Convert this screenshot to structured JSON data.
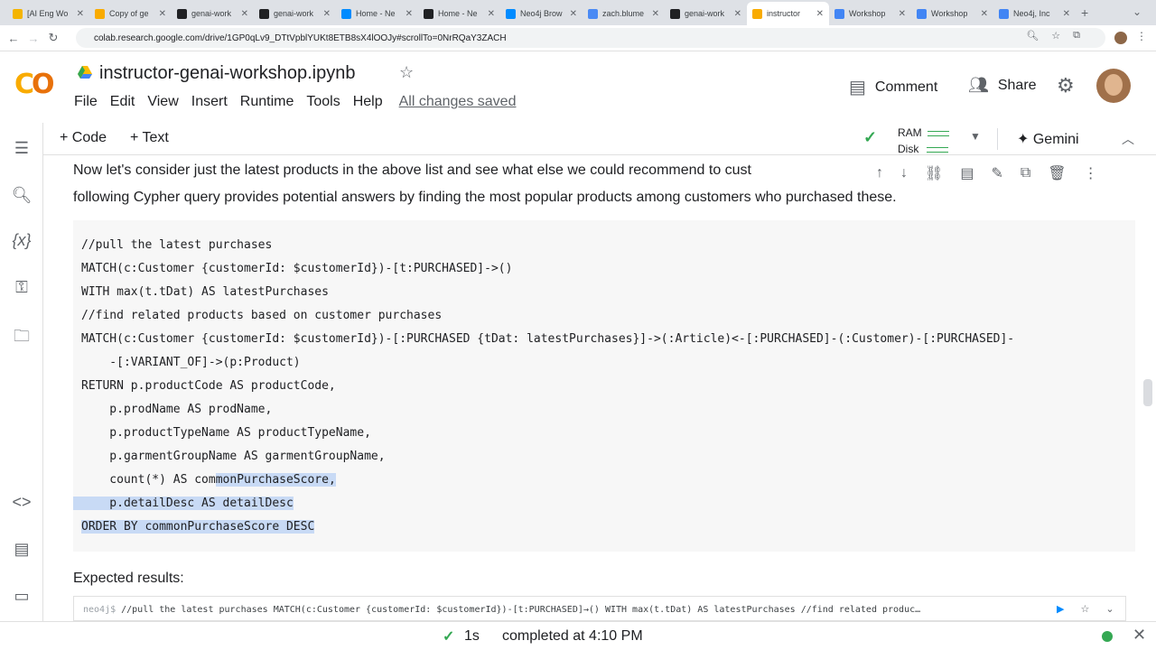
{
  "browser": {
    "tabs": [
      {
        "label": "[AI Eng Wo",
        "color": "#f4b400"
      },
      {
        "label": "Copy of ge",
        "color": "#f9ab00"
      },
      {
        "label": "genai-work",
        "color": "#202124"
      },
      {
        "label": "genai-work",
        "color": "#202124"
      },
      {
        "label": "Home - Ne",
        "color": "#018bff"
      },
      {
        "label": "Home - Ne",
        "color": "#202124"
      },
      {
        "label": "Neo4j Brow",
        "color": "#018bff"
      },
      {
        "label": "zach.blume",
        "color": "#4a8af4"
      },
      {
        "label": "genai-work",
        "color": "#202124"
      },
      {
        "label": "instructor",
        "color": "#f9ab00"
      },
      {
        "label": "Workshop",
        "color": "#4285f4"
      },
      {
        "label": "Workshop",
        "color": "#4285f4"
      },
      {
        "label": "Neo4j, Inc",
        "color": "#4285f4"
      }
    ],
    "url": "colab.research.google.com/drive/1GP0qLv9_DTtVpblYUKt8ETB8sX4lOOJy#scrollTo=0NrRQaY3ZACH"
  },
  "header": {
    "title": "instructor-genai-workshop.ipynb",
    "menu": [
      "File",
      "Edit",
      "View",
      "Insert",
      "Runtime",
      "Tools",
      "Help"
    ],
    "saved_status": "All changes saved",
    "comment_label": "Comment",
    "share_label": "Share"
  },
  "toolbar": {
    "code_label": "+ Code",
    "text_label": "+ Text",
    "ram_label": "RAM",
    "disk_label": "Disk",
    "gemini_label": "Gemini"
  },
  "markdown": {
    "line1": "Now let's consider just the latest products in the above list and see what else we could recommend to cust",
    "line2": "following Cypher query provides potential answers by finding the most popular products among customers who purchased these."
  },
  "code": {
    "lines": [
      "//pull the latest purchases",
      "MATCH(c:Customer {customerId: $customerId})-[t:PURCHASED]->()",
      "WITH max(t.tDat) AS latestPurchases",
      "//find related products based on customer purchases",
      "MATCH(c:Customer {customerId: $customerId})-[:PURCHASED {tDat: latestPurchases}]->(:Article)<-[:PURCHASED]-(:Customer)-[:PURCHASED]-",
      "    -[:VARIANT_OF]->(p:Product)",
      "RETURN p.productCode AS productCode,",
      "    p.prodName AS prodName,",
      "    p.productTypeName AS productTypeName,",
      "    p.garmentGroupName AS garmentGroupName,",
      "    count(*) AS com",
      "monPurchaseScore,",
      "    p.detailDesc AS detailDesc",
      "ORDER BY commonPurchaseScore DESC"
    ]
  },
  "expected": {
    "heading": "Expected results:",
    "prompt": "neo4j$",
    "query": "//pull the latest purchases MATCH(c:Customer {customerId: $customerId})-[t:PURCHASED]→() WITH max(t.tDat) AS latestPurchases //find related produc…"
  },
  "status": {
    "duration": "1s",
    "completed": "completed at 4:10 PM"
  }
}
